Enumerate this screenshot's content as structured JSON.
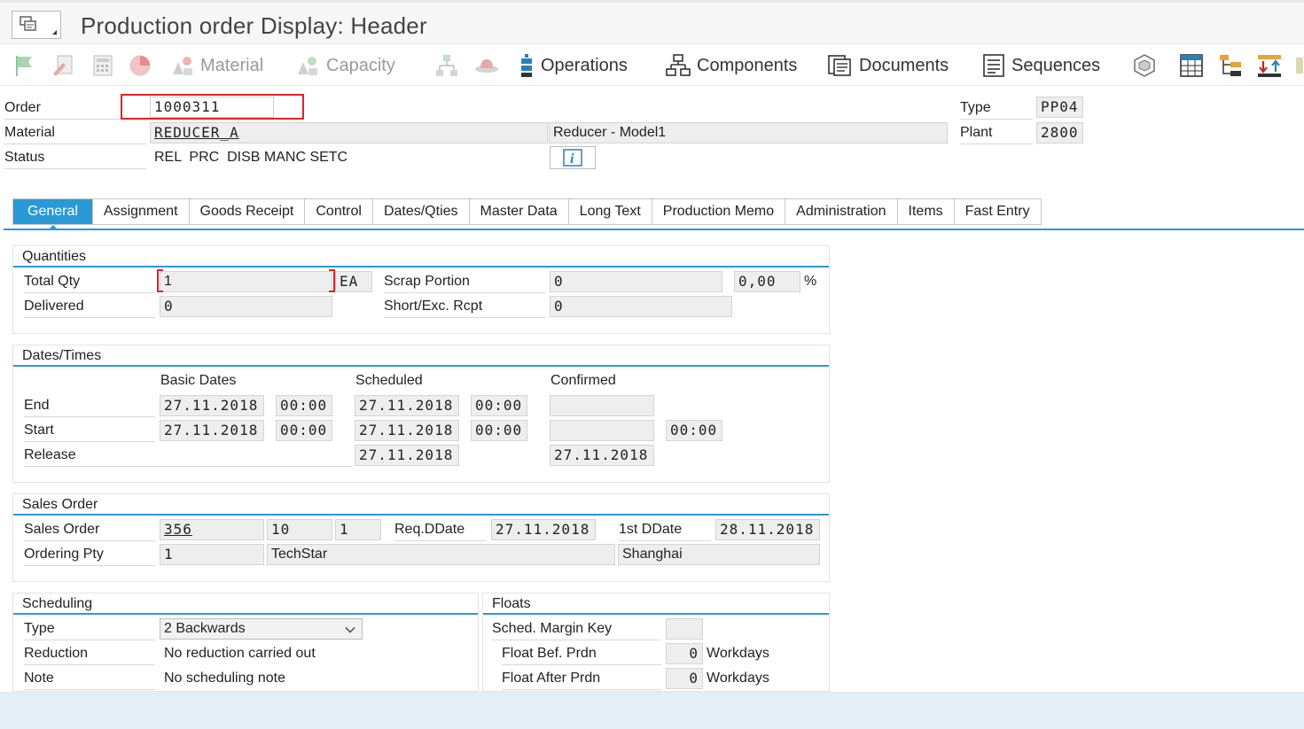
{
  "title": "Production order Display: Header",
  "toolbar": {
    "material": "Material",
    "capacity": "Capacity",
    "operations": "Operations",
    "components": "Components",
    "documents": "Documents",
    "sequences": "Sequences"
  },
  "header": {
    "order_label": "Order",
    "order_value": "1000311",
    "material_label": "Material",
    "material_value": "REDUCER_A",
    "material_desc": "Reducer - Model1",
    "status_label": "Status",
    "status_value": "REL  PRC  DISB MANC SETC",
    "type_label": "Type",
    "type_value": "PP04",
    "plant_label": "Plant",
    "plant_value": "2800"
  },
  "tabs": [
    "General",
    "Assignment",
    "Goods Receipt",
    "Control",
    "Dates/Qties",
    "Master Data",
    "Long Text",
    "Production Memo",
    "Administration",
    "Items",
    "Fast Entry"
  ],
  "quantities": {
    "title": "Quantities",
    "total_qty_label": "Total Qty",
    "total_qty": "1",
    "unit": "EA",
    "delivered_label": "Delivered",
    "delivered": "0",
    "scrap_label": "Scrap Portion",
    "scrap": "0",
    "scrap_pct": "0,00",
    "pct_sign": "%",
    "short_label": "Short/Exc. Rcpt",
    "short": "0"
  },
  "dates": {
    "title": "Dates/Times",
    "col_basic": "Basic Dates",
    "col_sched": "Scheduled",
    "col_conf": "Confirmed",
    "end_label": "End",
    "start_label": "Start",
    "release_label": "Release",
    "end_basic": "27.11.2018",
    "end_basic_time": "00:00",
    "end_sched": "27.11.2018",
    "end_sched_time": "00:00",
    "end_conf": "",
    "start_basic": "27.11.2018",
    "start_basic_time": "00:00",
    "start_sched": "27.11.2018",
    "start_sched_time": "00:00",
    "start_conf": "",
    "start_conf_time": "00:00",
    "release_sched": "27.11.2018",
    "release_conf": "27.11.2018"
  },
  "sales": {
    "title": "Sales Order",
    "so_label": "Sales Order",
    "so_value": "356",
    "so_item": "10",
    "so_sched": "1",
    "reqd_label": "Req.DDate",
    "reqd_value": "27.11.2018",
    "first_label": "1st DDate",
    "first_value": "28.11.2018",
    "op_label": "Ordering Pty",
    "op_value": "1",
    "op_name": "TechStar",
    "op_city": "Shanghai"
  },
  "scheduling": {
    "title": "Scheduling",
    "type_label": "Type",
    "type_value": "2 Backwards",
    "reduction_label": "Reduction",
    "reduction_value": "No reduction carried out",
    "note_label": "Note",
    "note_value": "No scheduling note"
  },
  "floats": {
    "title": "Floats",
    "margin_label": "Sched. Margin Key",
    "margin_value": "",
    "bef_label": "Float Bef. Prdn",
    "bef_value": "0",
    "after_label": "Float After Prdn",
    "after_value": "0",
    "unit": "Workdays"
  }
}
